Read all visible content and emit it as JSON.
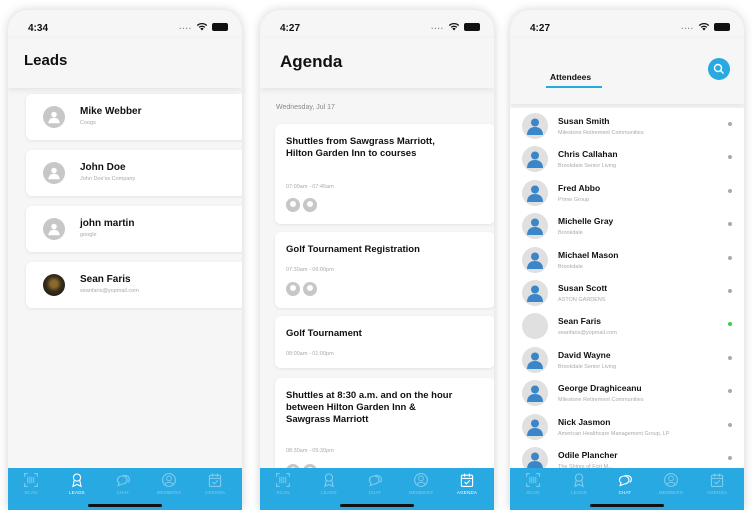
{
  "leads_screen": {
    "time": "4:34",
    "title": "Leads",
    "leads": [
      {
        "name": "Mike Webber",
        "company": "Coogs",
        "photo": false
      },
      {
        "name": "John Doe",
        "company": "John Doe'ss Company",
        "photo": false
      },
      {
        "name": "john martin",
        "company": "google",
        "photo": false
      },
      {
        "name": "Sean Faris",
        "company": "seanfaris@yopmail.com",
        "photo": true
      }
    ],
    "active_tab": "LEADS"
  },
  "agenda_screen": {
    "time": "4:27",
    "title": "Agenda",
    "date": "Wednesday, Jul 17",
    "events": [
      {
        "title": "Shuttles from Sawgrass Marriott, Hilton Garden Inn to courses",
        "time": "07:00am - 07:45am"
      },
      {
        "title": "Golf Tournament Registration",
        "time": "07:30am - 06:00pm"
      },
      {
        "title": "Golf Tournament",
        "time": "08:00am - 01:00pm"
      },
      {
        "title": "Shuttles at 8:30 a.m. and on the hour between Hilton Garden Inn & Sawgrass Marriott",
        "time": "08:30am - 05:30pm"
      }
    ],
    "active_tab": "AGENDA"
  },
  "attendees_screen": {
    "time": "4:27",
    "tab_label": "Attendees",
    "attendees": [
      {
        "name": "Susan Smith",
        "org": "Milestone Retirement Communities",
        "online": false,
        "photo": false
      },
      {
        "name": "Chris Callahan",
        "org": "Brookdale Senior Living",
        "online": false,
        "photo": false
      },
      {
        "name": "Fred Abbo",
        "org": "Prime Group",
        "online": false,
        "photo": false
      },
      {
        "name": "Michelle Gray",
        "org": "Brookdale",
        "online": false,
        "photo": false
      },
      {
        "name": "Michael Mason",
        "org": "Brookdale",
        "online": false,
        "photo": false
      },
      {
        "name": "Susan Scott",
        "org": "ASTON GARDENS",
        "online": false,
        "photo": false
      },
      {
        "name": "Sean Faris",
        "org": "seanfaris@yopmail.com",
        "online": true,
        "photo": true
      },
      {
        "name": "David Wayne",
        "org": "Brookdale Senior Living",
        "online": false,
        "photo": false
      },
      {
        "name": "George Draghiceanu",
        "org": "Milestone Retirement Communities",
        "online": false,
        "photo": false
      },
      {
        "name": "Nick Jasmon",
        "org": "American Healthcare Management Group, LP",
        "online": false,
        "photo": false
      },
      {
        "name": "Odile Plancher",
        "org": "The Shires of Fort M...",
        "online": false,
        "photo": false
      }
    ],
    "active_tab": "CHAT"
  },
  "tabbar": {
    "tabs": [
      {
        "label": "SCAN",
        "icon": "qr-scan-icon"
      },
      {
        "label": "LEADS",
        "icon": "leads-badge-icon"
      },
      {
        "label": "CHAT",
        "icon": "chat-bubbles-icon"
      },
      {
        "label": "MEMBERS",
        "icon": "members-icon"
      },
      {
        "label": "AGENDA",
        "icon": "calendar-icon"
      }
    ]
  },
  "colors": {
    "accent": "#29a9e1",
    "online": "#3bd04b",
    "avatar_placeholder": "#c7c7c7"
  }
}
